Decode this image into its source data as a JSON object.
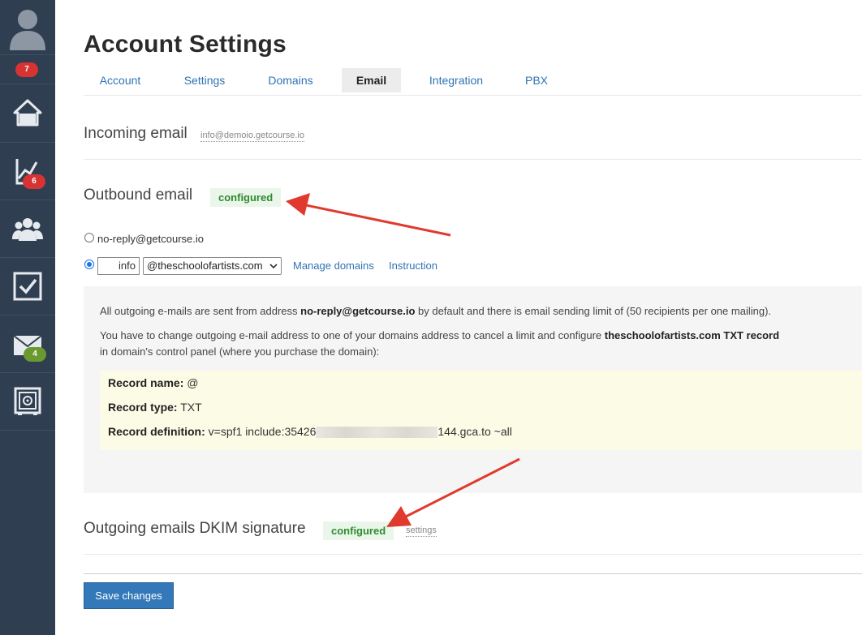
{
  "sidebar": {
    "avatar_badge": "7",
    "items": [
      {
        "icon": "home-icon",
        "badge": ""
      },
      {
        "icon": "chart-icon",
        "badge": "6"
      },
      {
        "icon": "users-icon",
        "badge": ""
      },
      {
        "icon": "checkbox-icon",
        "badge": ""
      },
      {
        "icon": "mail-icon",
        "badge": "4"
      },
      {
        "icon": "safe-icon",
        "badge": ""
      }
    ]
  },
  "page": {
    "title": "Account Settings"
  },
  "tabs": [
    {
      "label": "Account"
    },
    {
      "label": "Settings"
    },
    {
      "label": "Domains"
    },
    {
      "label": "Email",
      "active": true
    },
    {
      "label": "Integration"
    },
    {
      "label": "PBX"
    }
  ],
  "incoming": {
    "title": "Incoming email",
    "address": "info@demoio.getcourse.io"
  },
  "outbound": {
    "title": "Outbound email",
    "status": "configured",
    "option_default": "no-reply@getcourse.io",
    "local_part": "info",
    "domain_selected": "@theschoolofartists.com",
    "manage_domains": "Manage domains",
    "instruction": "Instruction"
  },
  "info": {
    "line1_a": "All outgoing e-mails are sent from address ",
    "line1_b": "no-reply@getcourse.io",
    "line1_c": " by default and there is email sending limit of (50 recipients per one mailing).",
    "line2_a": "You have to change outgoing e-mail address to one of your domains address to cancel a limit   and configure ",
    "line2_b": "theschoolofartists.com TXT record",
    "line3": "in domain's control panel (where you purchase the domain):",
    "record_name_label": "Record name:",
    "record_name_value": " @",
    "record_type_label": "Record type:",
    "record_type_value": " TXT",
    "record_def_label": "Record definition:",
    "record_def_prefix": " v=spf1 include:35426",
    "record_def_suffix": "144.gca.to ~all"
  },
  "dkim": {
    "title": "Outgoing emails DKIM signature",
    "status": "configured",
    "settings_link": "settings"
  },
  "save_label": "Save changes",
  "colors": {
    "sidebar": "#2f3e50",
    "link": "#2f73b3",
    "badge_red": "#d83333",
    "badge_green": "#6a9a2f",
    "status_green": "#2e8b2e",
    "button": "#3378b8",
    "arrow": "#e03a2f"
  }
}
